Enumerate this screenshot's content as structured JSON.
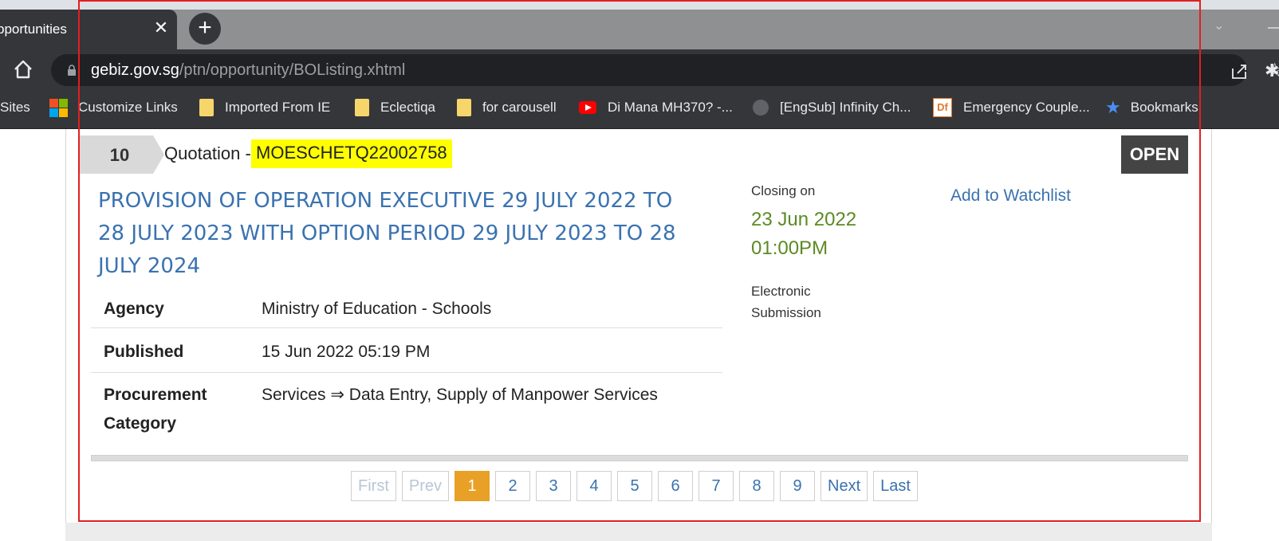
{
  "browser": {
    "tab_title": "pportunities",
    "tab_close": "✕",
    "new_tab": "+",
    "url_host": "gebiz.gov.sg",
    "url_path": "/ptn/opportunity/BOListing.xhtml",
    "bookmarks": [
      {
        "label": "Sites",
        "icon": "none"
      },
      {
        "label": "Customize Links",
        "icon": "microsoft-icon"
      },
      {
        "label": "Imported From IE",
        "icon": "folder-icon"
      },
      {
        "label": "Eclectiqa",
        "icon": "folder-icon"
      },
      {
        "label": "for carousell",
        "icon": "folder-icon"
      },
      {
        "label": "Di Mana MH370? -...",
        "icon": "youtube-icon"
      },
      {
        "label": "[EngSub] Infinity Ch...",
        "icon": "globe-icon"
      },
      {
        "label": "Emergency Couple...",
        "icon": "df-icon"
      },
      {
        "label": "Bookmarks",
        "icon": "star-icon"
      }
    ]
  },
  "listing": {
    "number": "10",
    "type_label": "Quotation -",
    "reference": "MOESCHETQ22002758",
    "status": "OPEN",
    "title": "PROVISION OF OPERATION EXECUTIVE 29 JULY 2022 TO 28 JULY 2023 WITH OPTION PERIOD 29 JULY 2023 TO 28 JULY 2024",
    "agency_label": "Agency",
    "agency_value": "Ministry of Education - Schools",
    "published_label": "Published",
    "published_value": "15 Jun 2022 05:19 PM",
    "category_label_1": "Procurement",
    "category_label_2": "Category",
    "category_value": "Services ⇒ Data Entry, Supply of Manpower Services",
    "closing_label": "Closing on",
    "closing_date": "23 Jun 2022",
    "closing_time": "01:00PM",
    "submission_1": "Electronic",
    "submission_2": "Submission",
    "watchlist": "Add to Watchlist"
  },
  "pagination": {
    "first": "First",
    "prev": "Prev",
    "pages": [
      "1",
      "2",
      "3",
      "4",
      "5",
      "6",
      "7",
      "8",
      "9"
    ],
    "current": "1",
    "next": "Next",
    "last": "Last"
  },
  "colors": {
    "link": "#3a72b0",
    "closing": "#5b8a23",
    "highlight": "#ffff00",
    "active_page": "#e8a027",
    "annotation_border": "#e02020"
  }
}
